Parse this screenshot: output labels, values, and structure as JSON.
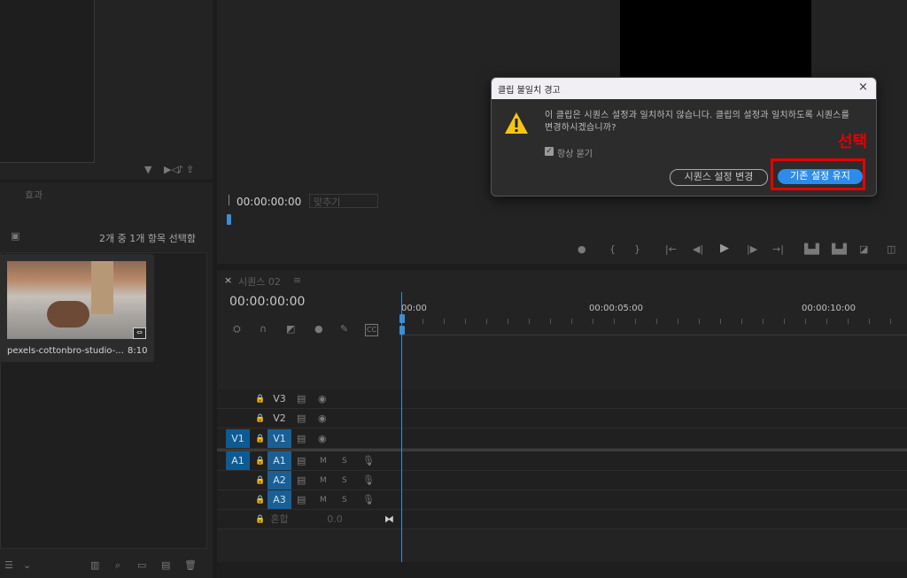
{
  "project_panel": {
    "tab_effects": "효과",
    "selection_info": "2개 중 1개 항목 선택함",
    "clip_name": "pexels-cottonbro-studio-...",
    "clip_duration": "8:10"
  },
  "program_monitor": {
    "timecode": "00:00:00:00",
    "fit_label": "맞추기"
  },
  "timeline": {
    "tab_label": "시퀀스 02",
    "close_glyph": "×",
    "menu_glyph": "≡",
    "timecode": "00:00:00:00",
    "ruler": [
      "00:00",
      "00:00:05:00",
      "00:00:10:00"
    ],
    "video_tracks": [
      {
        "name": "V3",
        "source": ""
      },
      {
        "name": "V2",
        "source": ""
      },
      {
        "name": "V1",
        "source": "V1"
      }
    ],
    "audio_tracks": [
      {
        "name": "A1",
        "source": "A1"
      },
      {
        "name": "A2",
        "source": ""
      },
      {
        "name": "A3",
        "source": ""
      }
    ],
    "mix_label": "혼합",
    "mix_value": "0.0",
    "mute_letter": "M",
    "solo_letter": "S"
  },
  "dialog": {
    "title": "클립 불일치 경고",
    "close_glyph": "×",
    "message": "이 클립은 시퀀스 설정과 일치하지 않습니다. 클립의 설정과 일치하도록 시퀀스를 변경하시겠습니까?",
    "checkbox_label": "항상 묻기",
    "checkbox_checked": true,
    "btn_change": "시퀀스 설정 변경",
    "btn_keep": "기존 설정 유지"
  },
  "annotation": {
    "label": "선택",
    "color": "#e50000"
  },
  "colors": {
    "accent_blue": "#2d8ceb",
    "track_blue": "#0d5b93",
    "playhead": "#3a8fd8"
  }
}
